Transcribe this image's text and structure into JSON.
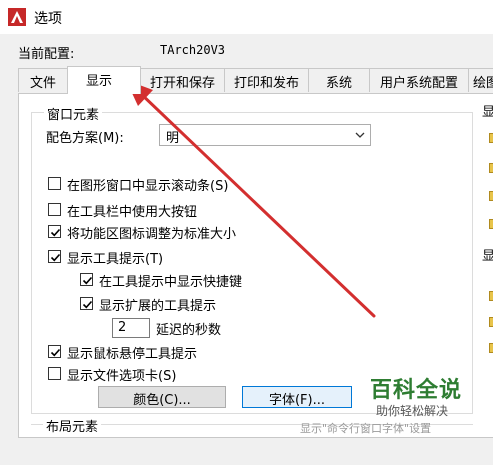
{
  "window": {
    "title": "选项"
  },
  "profile": {
    "label": "当前配置:",
    "value": "TArch20V3"
  },
  "tabs": [
    {
      "label": "文件"
    },
    {
      "label": "显示"
    },
    {
      "label": "打开和保存"
    },
    {
      "label": "打印和发布"
    },
    {
      "label": "系统"
    },
    {
      "label": "用户系统配置"
    },
    {
      "label": "绘图"
    }
  ],
  "window_elements": {
    "title": "窗口元素",
    "color_scheme_label": "配色方案(M):",
    "color_scheme_value": "明",
    "checkboxes": [
      {
        "label": "在图形窗口中显示滚动条(S)",
        "checked": false
      },
      {
        "label": "在工具栏中使用大按钮",
        "checked": false
      },
      {
        "label": "将功能区图标调整为标准大小",
        "checked": true
      },
      {
        "label": "显示工具提示(T)",
        "checked": true
      },
      {
        "label": "在工具提示中显示快捷键",
        "checked": true
      },
      {
        "label": "显示扩展的工具提示",
        "checked": true
      },
      {
        "label": "显示鼠标悬停工具提示",
        "checked": true
      },
      {
        "label": "显示文件选项卡(S)",
        "checked": false
      }
    ],
    "delay_value": "2",
    "delay_label": "延迟的秒数",
    "colors_button": "颜色(C)...",
    "fonts_button": "字体(F)..."
  },
  "layout_elements": {
    "title": "布局元素"
  },
  "right_groups": {
    "display_title": "显",
    "display_title_2": "显"
  },
  "watermark": {
    "main": "百科全说",
    "sub": "助你轻松解决"
  },
  "bottom_text": "显示\"命令行窗口字体\"设置",
  "colors": {
    "arrow": "#d32f2f",
    "checkbox_mark": "#000000",
    "watermark_green": "#2e7d32"
  }
}
